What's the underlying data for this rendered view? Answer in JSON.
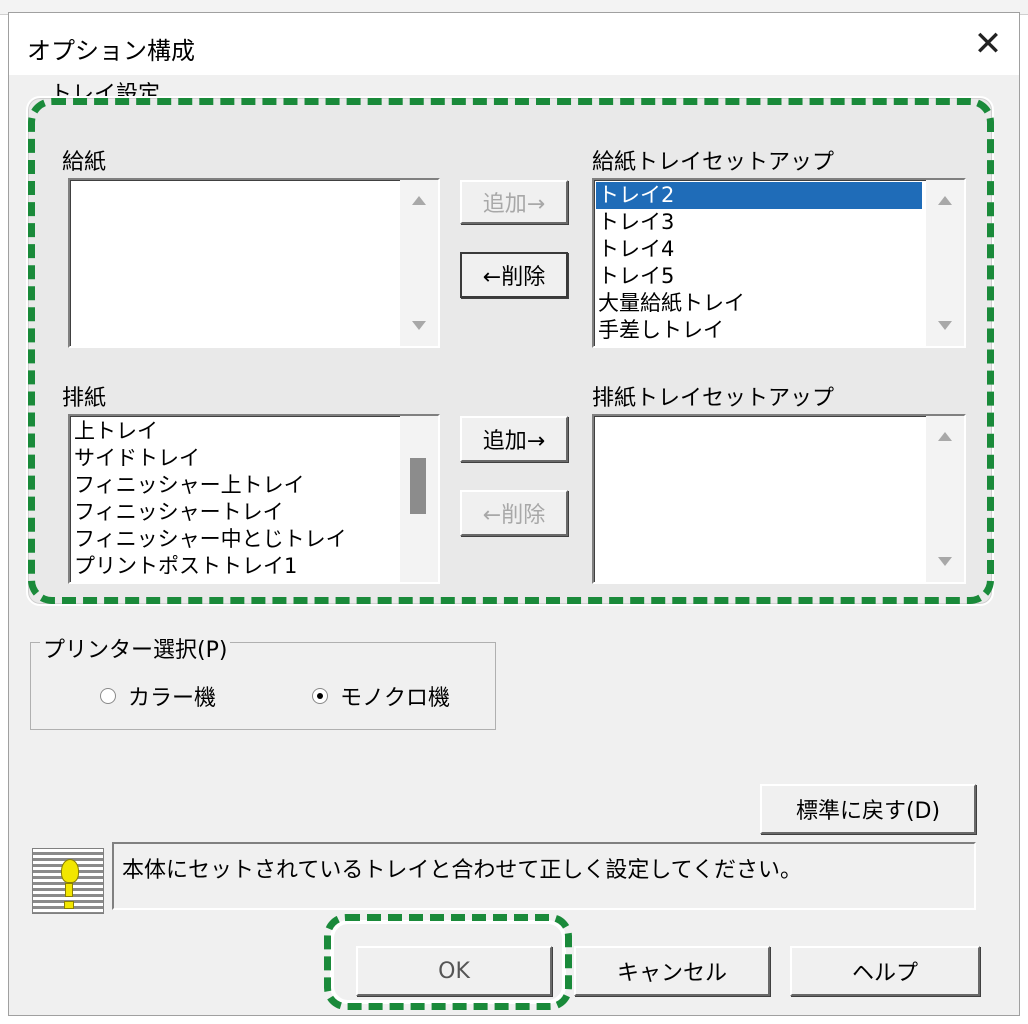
{
  "dialog": {
    "title": "オプション構成",
    "close_label": "✕",
    "partial_group_label": "トレイ設定"
  },
  "feed": {
    "label": "給紙",
    "list": [],
    "add_button": "追加→",
    "remove_button": "←削除",
    "add_enabled": false,
    "remove_enabled": true
  },
  "feed_setup": {
    "label": "給紙トレイセットアップ",
    "list": [
      "トレイ2",
      "トレイ3",
      "トレイ4",
      "トレイ5",
      "大量給紙トレイ",
      "手差しトレイ"
    ],
    "selected_index": 0
  },
  "output": {
    "label": "排紙",
    "list": [
      "上トレイ",
      "サイドトレイ",
      "フィニッシャー上トレイ",
      "フィニッシャートレイ",
      "フィニッシャー中とじトレイ",
      "プリントポストトレイ1"
    ],
    "add_button": "追加→",
    "remove_button": "←削除",
    "add_enabled": true,
    "remove_enabled": false
  },
  "output_setup": {
    "label": "排紙トレイセットアップ",
    "list": []
  },
  "printer_select": {
    "label": "プリンター選択(P)",
    "options": [
      {
        "label": "カラー機",
        "checked": false
      },
      {
        "label": "モノクロ機",
        "checked": true
      }
    ]
  },
  "buttons": {
    "restore_default": "標準に戻す(D)",
    "ok": "OK",
    "cancel": "キャンセル",
    "help": "ヘルプ"
  },
  "message": {
    "text": "本体にセットされているトレイと合わせて正しく設定してください。"
  },
  "icons": {
    "close": "close-icon",
    "hint": "lightbulb-icon",
    "scroll_up": "scroll-up-arrow-icon",
    "scroll_down": "scroll-down-arrow-icon"
  },
  "colors": {
    "highlight_frame": "#1a8a3a",
    "selection": "#1f6cb8",
    "dialog_bg": "#f0f0f0"
  }
}
